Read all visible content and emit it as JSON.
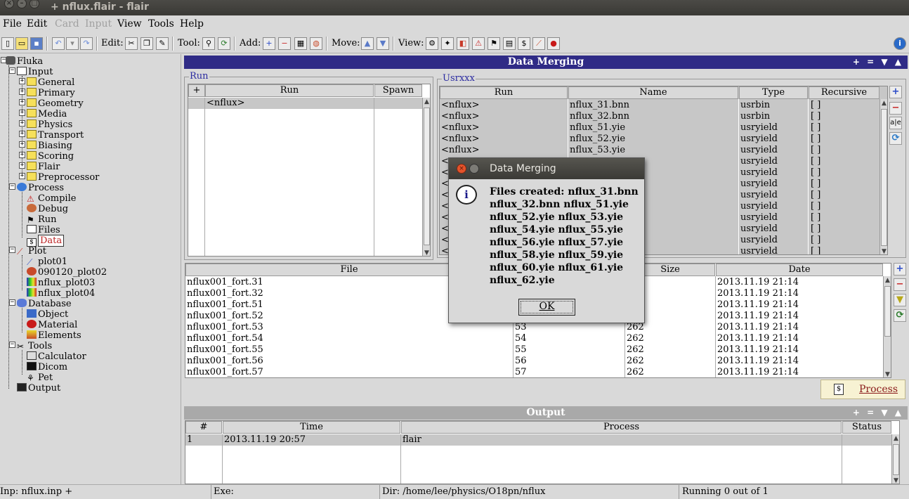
{
  "window": {
    "title": "+ nflux.flair - flair"
  },
  "menubar": [
    {
      "label": "File",
      "enabled": true
    },
    {
      "label": "Edit",
      "enabled": true
    },
    {
      "label": "Card",
      "enabled": false
    },
    {
      "label": "Input",
      "enabled": false
    },
    {
      "label": "View",
      "enabled": true
    },
    {
      "label": "Tools",
      "enabled": true
    },
    {
      "label": "Help",
      "enabled": true
    }
  ],
  "toolbar": {
    "edit_label": "Edit:",
    "tool_label": "Tool:",
    "add_label": "Add:",
    "move_label": "Move:",
    "view_label": "View:"
  },
  "tree": {
    "items": [
      {
        "label": "Fluka",
        "icon": "fluka-icon"
      },
      {
        "label": "Input",
        "icon": "input-icon"
      },
      {
        "label": "General",
        "icon": "folder-icon"
      },
      {
        "label": "Primary",
        "icon": "folder-icon"
      },
      {
        "label": "Geometry",
        "icon": "folder-icon"
      },
      {
        "label": "Media",
        "icon": "folder-icon"
      },
      {
        "label": "Physics",
        "icon": "folder-icon"
      },
      {
        "label": "Transport",
        "icon": "folder-icon"
      },
      {
        "label": "Biasing",
        "icon": "folder-icon"
      },
      {
        "label": "Scoring",
        "icon": "folder-icon"
      },
      {
        "label": "Flair",
        "icon": "folder-icon"
      },
      {
        "label": "Preprocessor",
        "icon": "folder-icon"
      },
      {
        "label": "Process",
        "icon": "process-icon"
      },
      {
        "label": "Compile",
        "icon": "compile-icon"
      },
      {
        "label": "Debug",
        "icon": "debug-icon"
      },
      {
        "label": "Run",
        "icon": "run-icon"
      },
      {
        "label": "Files",
        "icon": "files-icon"
      },
      {
        "label": "Data",
        "icon": "data-icon",
        "selected": true
      },
      {
        "label": "Plot",
        "icon": "plot-icon"
      },
      {
        "label": "plot01",
        "icon": "plot-line-icon"
      },
      {
        "label": "090120_plot02",
        "icon": "plot-geo-icon"
      },
      {
        "label": "nflux_plot03",
        "icon": "plot-usrbin-icon"
      },
      {
        "label": "nflux_plot04",
        "icon": "plot-usrbin-icon"
      },
      {
        "label": "Database",
        "icon": "database-icon"
      },
      {
        "label": "Object",
        "icon": "object-icon"
      },
      {
        "label": "Material",
        "icon": "material-icon"
      },
      {
        "label": "Elements",
        "icon": "elements-icon"
      },
      {
        "label": "Tools",
        "icon": "tools-icon"
      },
      {
        "label": "Calculator",
        "icon": "calculator-icon"
      },
      {
        "label": "Dicom",
        "icon": "dicom-icon"
      },
      {
        "label": "Pet",
        "icon": "pet-icon"
      },
      {
        "label": "Output",
        "icon": "output-icon"
      }
    ]
  },
  "main": {
    "header": "Data Merging",
    "header_controls": "+ = ▼ ▲",
    "run_group": {
      "label": "Run",
      "add": "+",
      "columns": [
        "Run",
        "Spawn"
      ],
      "rows": [
        {
          "run": "<nflux>",
          "spawn": ""
        }
      ]
    },
    "usrxxx_group": {
      "label": "Usrxxx",
      "columns": [
        "Run",
        "Name",
        "Type",
        "Recursive"
      ],
      "rows": [
        {
          "run": "<nflux>",
          "name": "nflux_31.bnn",
          "type": "usrbin",
          "rec": "[ ]"
        },
        {
          "run": "<nflux>",
          "name": "nflux_32.bnn",
          "type": "usrbin",
          "rec": "[ ]"
        },
        {
          "run": "<nflux>",
          "name": "nflux_51.yie",
          "type": "usryield",
          "rec": "[ ]"
        },
        {
          "run": "<nflux>",
          "name": "nflux_52.yie",
          "type": "usryield",
          "rec": "[ ]"
        },
        {
          "run": "<nflux>",
          "name": "nflux_53.yie",
          "type": "usryield",
          "rec": "[ ]"
        },
        {
          "run": "<",
          "name": "",
          "type": "usryield",
          "rec": "[ ]"
        },
        {
          "run": "<",
          "name": "",
          "type": "usryield",
          "rec": "[ ]"
        },
        {
          "run": "<",
          "name": "",
          "type": "usryield",
          "rec": "[ ]"
        },
        {
          "run": "<",
          "name": "",
          "type": "usryield",
          "rec": "[ ]"
        },
        {
          "run": "<",
          "name": "",
          "type": "usryield",
          "rec": "[ ]"
        },
        {
          "run": "<",
          "name": "",
          "type": "usryield",
          "rec": "[ ]"
        },
        {
          "run": "<",
          "name": "",
          "type": "usryield",
          "rec": "[ ]"
        },
        {
          "run": "<",
          "name": "",
          "type": "usryield",
          "rec": "[ ]"
        },
        {
          "run": "<",
          "name": "",
          "type": "usryield",
          "rec": "[ ]"
        }
      ]
    },
    "files_table": {
      "columns": [
        "File",
        "",
        "Size",
        "Date"
      ],
      "rows": [
        {
          "file": "nflux001_fort.31",
          "unit": "",
          "size": "",
          "date": "2013.11.19 21:14"
        },
        {
          "file": "nflux001_fort.32",
          "unit": "",
          "size": "",
          "date": "2013.11.19 21:14"
        },
        {
          "file": "nflux001_fort.51",
          "unit": "",
          "size": "",
          "date": "2013.11.19 21:14"
        },
        {
          "file": "nflux001_fort.52",
          "unit": "",
          "size": "",
          "date": "2013.11.19 21:14"
        },
        {
          "file": "nflux001_fort.53",
          "unit": "53",
          "size": "262",
          "date": "2013.11.19 21:14"
        },
        {
          "file": "nflux001_fort.54",
          "unit": "54",
          "size": "262",
          "date": "2013.11.19 21:14"
        },
        {
          "file": "nflux001_fort.55",
          "unit": "55",
          "size": "262",
          "date": "2013.11.19 21:14"
        },
        {
          "file": "nflux001_fort.56",
          "unit": "56",
          "size": "262",
          "date": "2013.11.19 21:14"
        },
        {
          "file": "nflux001_fort.57",
          "unit": "57",
          "size": "262",
          "date": "2013.11.19 21:14"
        }
      ]
    },
    "process_button": "Process"
  },
  "output": {
    "header": "Output",
    "header_controls": "+ = ▼ ▲",
    "columns": [
      "#",
      "Time",
      "Process",
      "Status"
    ],
    "rows": [
      {
        "num": "1",
        "time": "2013.11.19 20:57",
        "process": "flair",
        "status": ""
      }
    ]
  },
  "statusbar": {
    "inp": "Inp: nflux.inp +",
    "exe": "Exe:",
    "dir": "Dir: /home/lee/physics/O18pn/nflux",
    "running": "Running 0 out of 1"
  },
  "dialog": {
    "title": "Data Merging",
    "message": "Files created: nflux_31.bnn nflux_32.bnn nflux_51.yie nflux_52.yie nflux_53.yie nflux_54.yie nflux_55.yie nflux_56.yie nflux_57.yie nflux_58.yie nflux_59.yie nflux_60.yie nflux_61.yie nflux_62.yie",
    "ok": "OK"
  }
}
